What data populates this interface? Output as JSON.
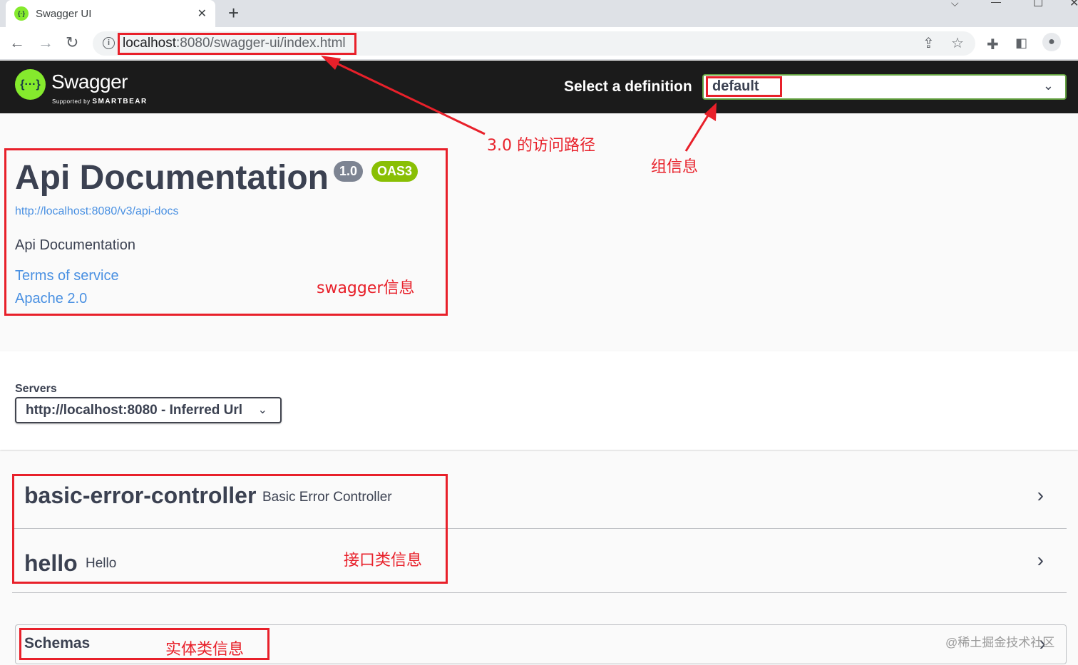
{
  "browser": {
    "tab_title": "Swagger UI",
    "tab_close": "✕",
    "new_tab": "+",
    "url_host": "localhost",
    "url_rest": ":8080/swagger-ui/index.html"
  },
  "topbar": {
    "logo_text": "Swagger",
    "logo_sub_prefix": "Supported by",
    "logo_sub_brand": "SMARTBEAR",
    "definition_label": "Select a definition",
    "definition_value": "default"
  },
  "info": {
    "title": "Api Documentation",
    "version_badge": "1.0",
    "oas_badge": "OAS3",
    "api_docs_link": "http://localhost:8080/v3/api-docs",
    "description": "Api Documentation",
    "terms_link": "Terms of service",
    "license_link": "Apache 2.0"
  },
  "servers": {
    "label": "Servers",
    "selected": "http://localhost:8080 - Inferred Url"
  },
  "tags": [
    {
      "name": "basic-error-controller",
      "description": "Basic Error Controller"
    },
    {
      "name": "hello",
      "description": "Hello"
    }
  ],
  "models": {
    "label": "Schemas"
  },
  "annotations": {
    "path_note": "3.0 的访问路径",
    "group_note": "组信息",
    "swagger_note": "swagger信息",
    "controller_note": "接口类信息",
    "schema_note": "实体类信息"
  },
  "watermark": "@稀土掘金技术社区",
  "colors": {
    "swagger_green": "#85ea2d",
    "topbar_bg": "#1b1b1b",
    "link_blue": "#4990e2",
    "oas_green": "#89bf04",
    "version_gray": "#7d8492",
    "annotation_red": "#e8202a"
  }
}
